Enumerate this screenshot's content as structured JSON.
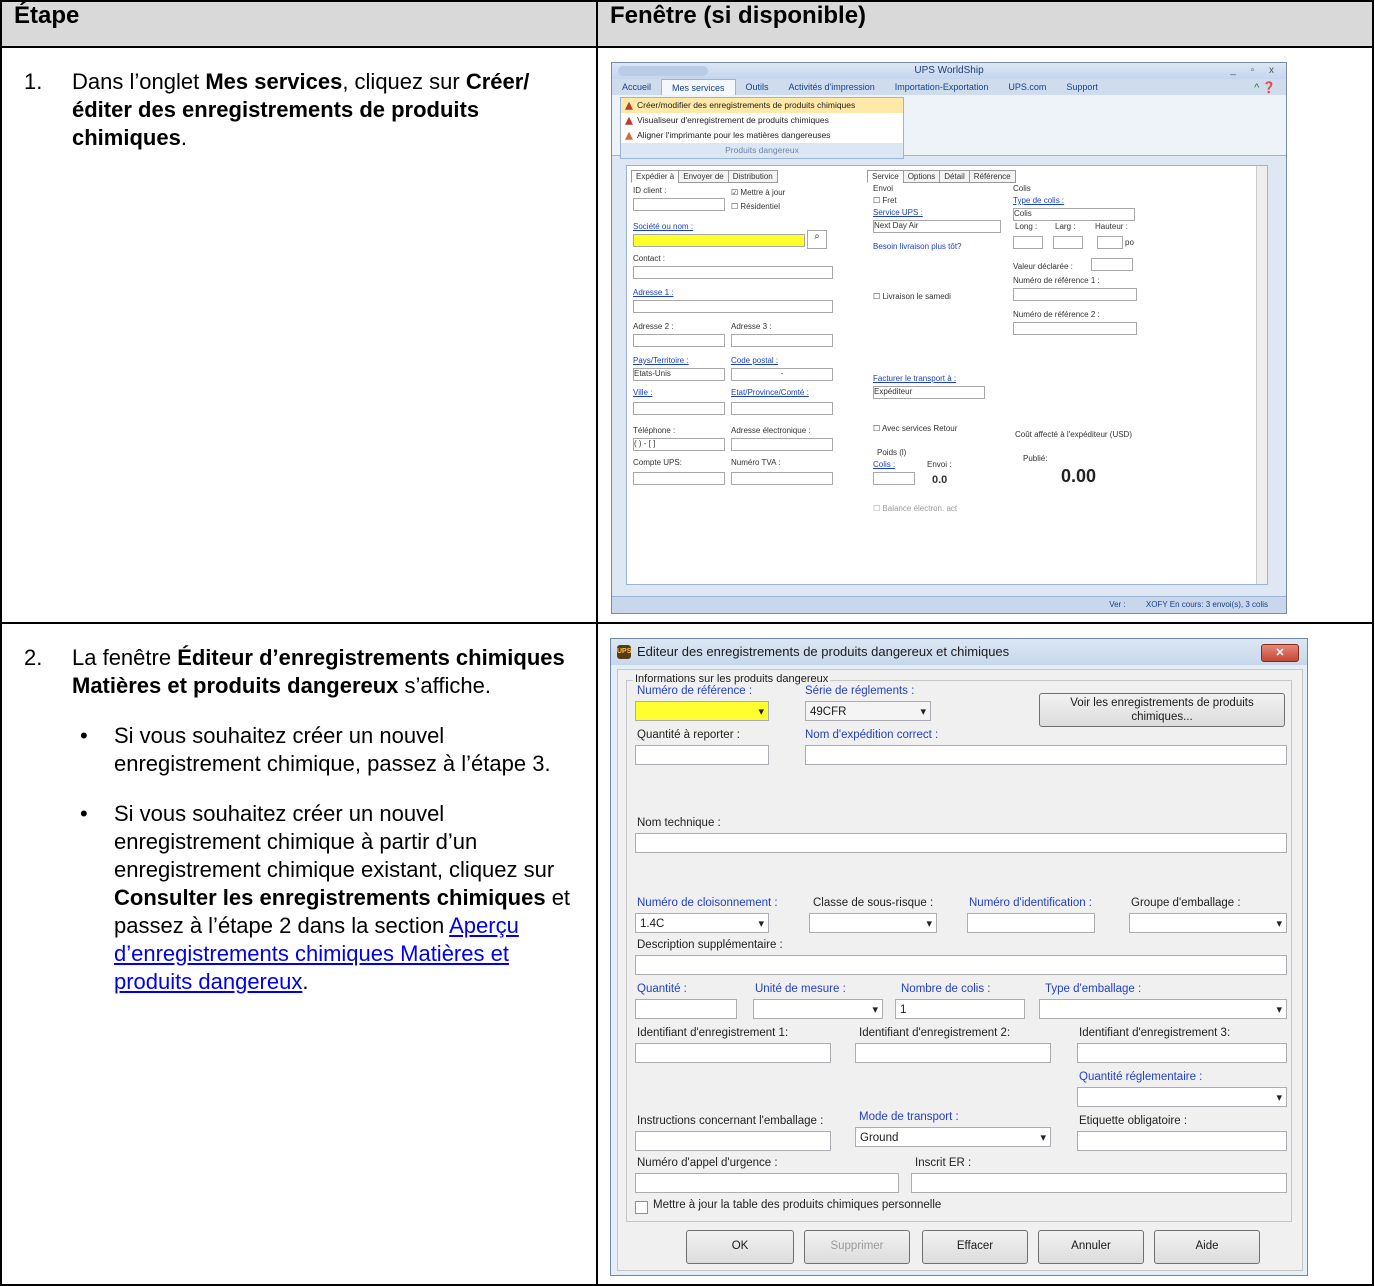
{
  "headers": {
    "col1": "Étape",
    "col2": "Fenêtre (si disponible)"
  },
  "step1": {
    "num": "1.",
    "t1": "Dans l’onglet ",
    "b1": "Mes services",
    "t2": ", cliquez sur ",
    "b2": "Créer/éditer des enregistrements de produits chimiques",
    "t3": "."
  },
  "step2": {
    "num": "2.",
    "t1": "La fenêtre ",
    "b1": "Éditeur d’enregistrements chimiques Matières et produits dangereux",
    "t2": " s’affiche.",
    "bullet1": "Si vous souhaitez créer un nouvel enregistrement chimique, passez à l’étape 3.",
    "bullet2_t1": "Si vous souhaitez créer un nouvel enregistrement chimique à partir d’un enregistrement chimique existant, cliquez sur ",
    "bullet2_b1": "Consulter les enregistrements chimiques",
    "bullet2_t2": " et passez à l’étape 2 dans la section ",
    "bullet2_link": "Aperçu d’enregistrements chimiques Matières et produits dangereux",
    "bullet2_t3": "."
  },
  "worldship": {
    "title": "UPS WorldShip",
    "tabs": [
      "Accueil",
      "Mes services",
      "Outils",
      "Activités d'impression",
      "Importation-Exportation",
      "UPS.com",
      "Support"
    ],
    "menu": [
      "Créer/modifier des enregistrements de produits chimiques",
      "Visualiseur d'enregistrement de produits chimiques",
      "Aligner l'imprimante pour les matières dangereuses"
    ],
    "menu_group": "Produits dangereux",
    "left_tabs": [
      "Expédier à",
      "Envoyer de",
      "Distribution"
    ],
    "mid_tabs": [
      "Service",
      "Options",
      "Détail",
      "Référence"
    ],
    "labels": {
      "id_client": "ID client :",
      "mettre_a_jour": "Mettre à jour",
      "residentiel": "Résidentiel",
      "societe": "Société ou nom :",
      "contact": "Contact :",
      "adresse1": "Adresse 1 :",
      "adresse2": "Adresse 2 :",
      "adresse3": "Adresse 3 :",
      "pays": "Pays/Territoire :",
      "pays_val": "Etats-Unis",
      "code_postal": "Code postal :",
      "code_postal_val": "-",
      "ville": "Ville :",
      "etat": "Etat/Province/Comté :",
      "telephone": "Téléphone :",
      "telephone_val": "( ) -  [ ]",
      "adresse_el": "Adresse électronique :",
      "compte": "Compte UPS:",
      "tva": "Numéro TVA :",
      "envoi": "Envoi",
      "fret": "Fret",
      "service_ups": "Service UPS :",
      "service_val": "Next Day Air",
      "besoin": "Besoin livraison plus tôt?",
      "samedi": "Livraison le samedi",
      "facturer": "Facturer le transport à :",
      "facturer_val": "Expéditeur",
      "retour": "Avec services Retour",
      "poids": "Poids (l)",
      "colis_lbl": "Colis :",
      "envoi_lbl": "Envoi :",
      "envoi_val": "0.0",
      "balance": "Balance électron. act",
      "colis": "Colis",
      "type_colis": "Type de colis :",
      "type_colis_val": "Colis",
      "long": "Long :",
      "larg": "Larg :",
      "hauteur": "Hauteur :",
      "po": "po",
      "valeur": "Valeur déclarée :",
      "ref1": "Numéro de référence 1 :",
      "ref2": "Numéro de référence 2 :",
      "cout": "Coût affecté à l'expéditeur (USD)",
      "publie": "Publié:",
      "total": "0.00"
    },
    "status": {
      "ver": "Ver :",
      "info": "XOFY  En cours: 3 envoi(s), 3 colis"
    }
  },
  "editor": {
    "title": "Editeur des enregistrements de produits dangereux et chimiques",
    "close": "✕",
    "group": "Informations sur les produits dangereux",
    "numero_ref": "Numéro de référence :",
    "serie": "Série de réglements :",
    "serie_val": "49CFR",
    "voir_btn": "Voir les enregistrements de produits chimiques...",
    "quantite_reporter": "Quantité à reporter :",
    "nom_expedition": "Nom d'expédition correct :",
    "nom_technique": "Nom technique :",
    "num_cloison": "Numéro de cloisonnement :",
    "num_cloison_val": "1.4C",
    "classe_sous": "Classe de sous-risque :",
    "num_ident": "Numéro d'identification :",
    "groupe_emb": "Groupe d'emballage :",
    "desc_supp": "Description supplémentaire :",
    "quantite": "Quantité :",
    "unite": "Unité de mesure :",
    "nb_colis": "Nombre de colis :",
    "nb_colis_val": "1",
    "type_emb": "Type d'emballage :",
    "ident1": "Identifiant d'enregistrement 1:",
    "ident2": "Identifiant d'enregistrement 2:",
    "ident3": "Identifiant d'enregistrement 3:",
    "qte_regl": "Quantité réglementaire :",
    "instructions": "Instructions concernant l'emballage :",
    "mode_transport": "Mode de transport :",
    "mode_val": "Ground",
    "etiquette": "Etiquette obligatoire :",
    "num_urgence": "Numéro d'appel d'urgence :",
    "inscrit_er": "Inscrit ER :",
    "checkbox": "Mettre à jour la table des produits chimiques personnelle",
    "buttons": [
      "OK",
      "Supprimer",
      "Effacer",
      "Annuler",
      "Aide"
    ]
  }
}
